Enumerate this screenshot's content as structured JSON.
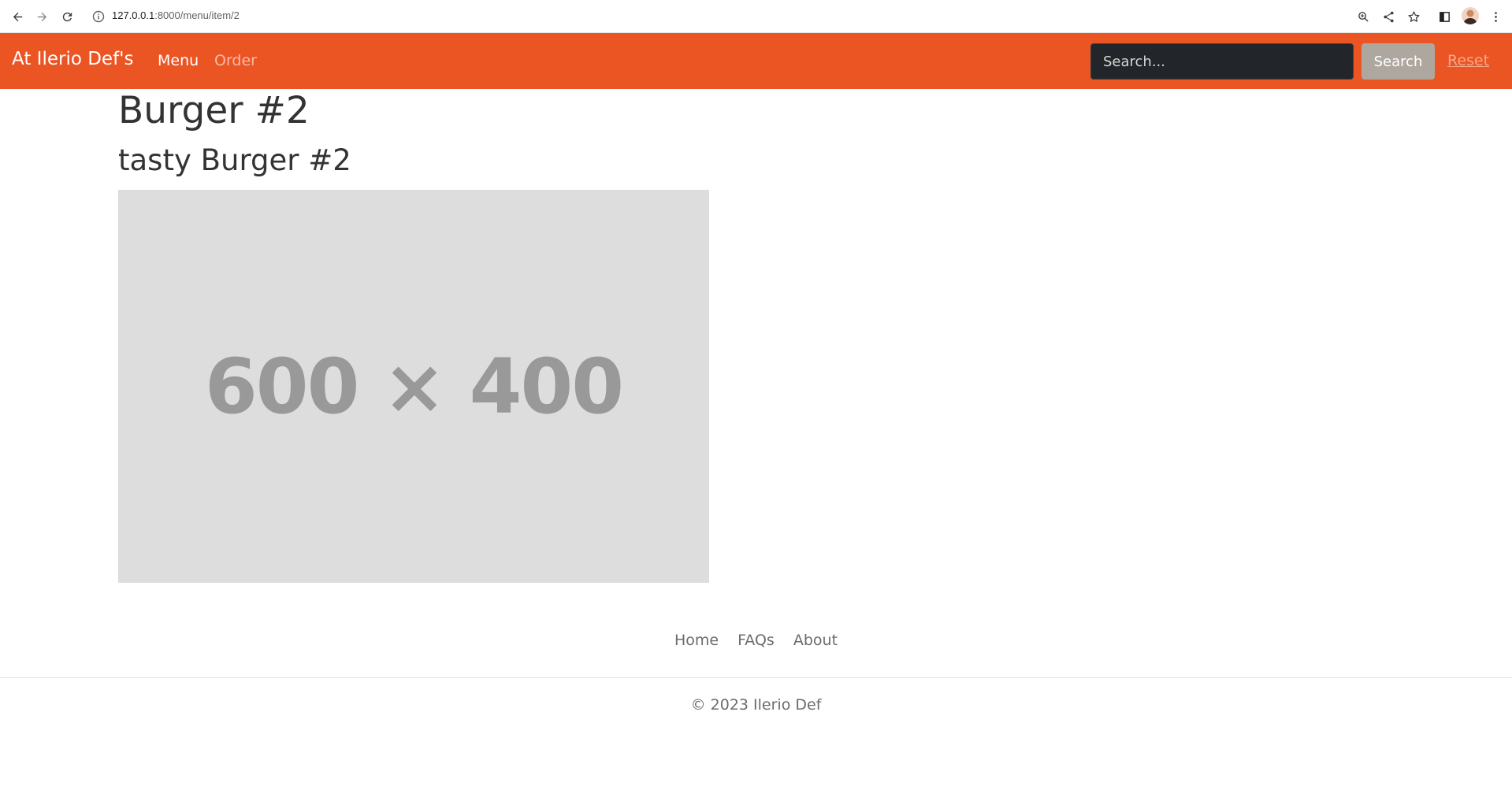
{
  "browser": {
    "url_host": "127.0.0.1",
    "url_rest": ":8000/menu/item/2",
    "icons": [
      "back-icon",
      "forward-icon",
      "reload-icon",
      "info-icon",
      "zoom-icon",
      "share-icon",
      "star-icon",
      "sidebar-icon",
      "avatar",
      "more-icon"
    ]
  },
  "navbar": {
    "brand": "At Ilerio Def's",
    "links": {
      "menu": "Menu",
      "order": "Order"
    },
    "search_placeholder": "Search...",
    "search_button": "Search",
    "reset": "Reset",
    "bg_color": "#eb5423"
  },
  "item": {
    "title": "Burger #2",
    "description": "tasty Burger #2",
    "image_text": "600 × 400"
  },
  "footer": {
    "links": {
      "home": "Home",
      "faqs": "FAQs",
      "about": "About"
    },
    "copyright": "© 2023 Ilerio Def"
  }
}
